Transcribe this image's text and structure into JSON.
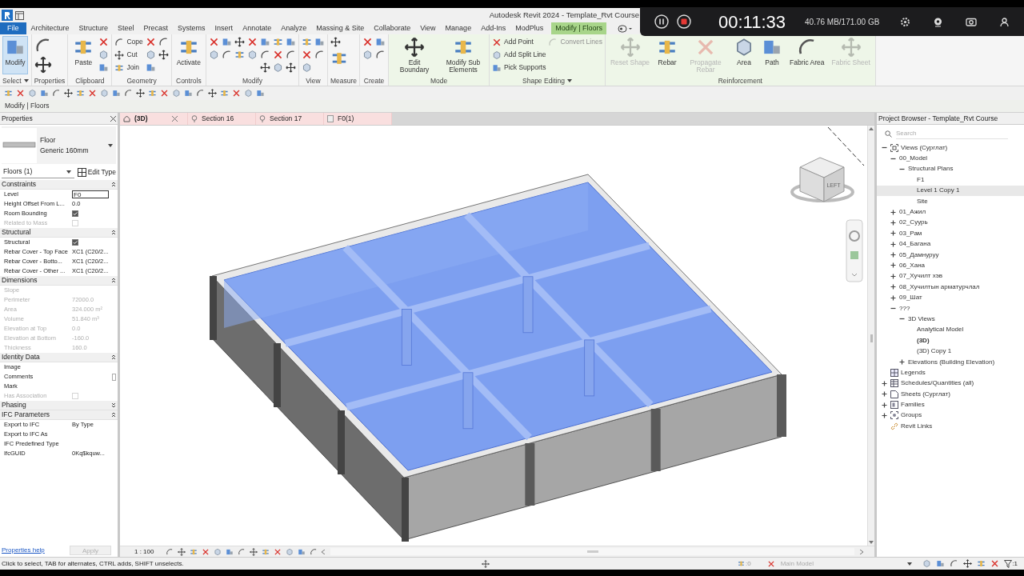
{
  "window": {
    "title": "Autodesk Revit 2024 - Template_Rvt Course"
  },
  "recorder": {
    "time": "00:11:33",
    "storage": "40.76 MB/171.00 GB"
  },
  "menu_tabs": [
    {
      "label": "File",
      "kind": "file",
      "selected": false
    },
    {
      "label": "Architecture",
      "kind": "tab",
      "selected": false
    },
    {
      "label": "Structure",
      "kind": "tab",
      "selected": false
    },
    {
      "label": "Steel",
      "kind": "tab",
      "selected": false
    },
    {
      "label": "Precast",
      "kind": "tab",
      "selected": false
    },
    {
      "label": "Systems",
      "kind": "tab",
      "selected": false
    },
    {
      "label": "Insert",
      "kind": "tab",
      "selected": false
    },
    {
      "label": "Annotate",
      "kind": "tab",
      "selected": false
    },
    {
      "label": "Analyze",
      "kind": "tab",
      "selected": false
    },
    {
      "label": "Massing & Site",
      "kind": "tab",
      "selected": false
    },
    {
      "label": "Collaborate",
      "kind": "tab",
      "selected": false
    },
    {
      "label": "View",
      "kind": "tab",
      "selected": false
    },
    {
      "label": "Manage",
      "kind": "tab",
      "selected": false
    },
    {
      "label": "Add-Ins",
      "kind": "tab",
      "selected": false
    },
    {
      "label": "ModPlus",
      "kind": "tab",
      "selected": false
    },
    {
      "label": "Modify | Floors",
      "kind": "contextual",
      "selected": true
    }
  ],
  "ribbon_panels": [
    {
      "title": "Select",
      "dropdown": true,
      "contextual": false,
      "columns": [
        [
          {
            "kind": "large",
            "label": "Modify",
            "selected": true
          }
        ]
      ]
    },
    {
      "title": "Properties",
      "contextual": false,
      "columns": [
        [
          {
            "kind": "big_icon"
          },
          {
            "kind": "big_icon"
          }
        ]
      ]
    },
    {
      "title": "Clipboard",
      "contextual": false,
      "columns": [
        [
          {
            "kind": "large",
            "label": "Paste",
            "selected": false
          }
        ],
        [
          {
            "kind": "icon"
          },
          {
            "kind": "icon"
          },
          {
            "kind": "icon"
          }
        ]
      ]
    },
    {
      "title": "Geometry",
      "contextual": false,
      "columns": [
        [
          {
            "kind": "small",
            "label": "Cope"
          },
          {
            "kind": "small",
            "label": "Cut"
          },
          {
            "kind": "small",
            "label": "Join"
          }
        ],
        [
          {
            "kind": "icon"
          },
          {
            "kind": "icon"
          },
          {
            "kind": "icon"
          }
        ],
        [
          {
            "kind": "icon"
          },
          {
            "kind": "icon"
          }
        ]
      ]
    },
    {
      "title": "Controls",
      "contextual": false,
      "columns": [
        [
          {
            "kind": "large",
            "label": "Activate",
            "selected": false
          }
        ]
      ]
    },
    {
      "title": "Modify",
      "contextual": false,
      "columns": [
        [
          {
            "kind": "icon"
          },
          {
            "kind": "icon"
          }
        ],
        [
          {
            "kind": "icon"
          },
          {
            "kind": "icon"
          }
        ],
        [
          {
            "kind": "icon"
          },
          {
            "kind": "icon"
          }
        ],
        [
          {
            "kind": "icon"
          },
          {
            "kind": "icon"
          }
        ],
        [
          {
            "kind": "icon"
          },
          {
            "kind": "icon"
          },
          {
            "kind": "icon"
          }
        ],
        [
          {
            "kind": "icon"
          },
          {
            "kind": "icon"
          },
          {
            "kind": "icon"
          }
        ],
        [
          {
            "kind": "icon"
          },
          {
            "kind": "icon"
          },
          {
            "kind": "icon"
          }
        ]
      ]
    },
    {
      "title": "View",
      "contextual": false,
      "columns": [
        [
          {
            "kind": "icon"
          },
          {
            "kind": "icon"
          },
          {
            "kind": "icon"
          }
        ],
        [
          {
            "kind": "icon"
          },
          {
            "kind": "icon"
          }
        ]
      ]
    },
    {
      "title": "Measure",
      "contextual": false,
      "columns": [
        [
          {
            "kind": "icon"
          },
          {
            "kind": "big_icon"
          }
        ]
      ]
    },
    {
      "title": "Create",
      "contextual": false,
      "columns": [
        [
          {
            "kind": "icon"
          },
          {
            "kind": "icon"
          }
        ],
        [
          {
            "kind": "icon"
          },
          {
            "kind": "icon"
          }
        ]
      ]
    },
    {
      "title": "Mode",
      "contextual": true,
      "columns": [
        [
          {
            "kind": "large",
            "label": "Edit Boundary",
            "selected": false
          }
        ],
        [
          {
            "kind": "large",
            "label": "Modify Sub Elements",
            "selected": false
          }
        ]
      ]
    },
    {
      "title": "Shape Editing",
      "dropdown": true,
      "contextual": true,
      "columns": [
        [
          {
            "kind": "small",
            "label": "Add Point"
          },
          {
            "kind": "small",
            "label": "Add Split Line"
          },
          {
            "kind": "small",
            "label": "Pick Supports"
          }
        ],
        [
          {
            "kind": "small",
            "label": "Convert Lines",
            "disabled": true
          }
        ]
      ]
    },
    {
      "title": "Reinforcement",
      "contextual": true,
      "columns": [
        [
          {
            "kind": "large",
            "label": "Reset Shape",
            "disabled": true
          }
        ],
        [
          {
            "kind": "large",
            "label": "Rebar",
            "selected": false
          }
        ],
        [
          {
            "kind": "large",
            "label": "Propagate Rebar",
            "disabled": true
          }
        ],
        [
          {
            "kind": "large",
            "label": "Area",
            "selected": false
          }
        ],
        [
          {
            "kind": "large",
            "label": "Path",
            "selected": false
          }
        ],
        [
          {
            "kind": "large",
            "label": "Fabric Area",
            "selected": false
          }
        ],
        [
          {
            "kind": "large",
            "label": "Fabric Sheet",
            "disabled": true
          }
        ]
      ]
    }
  ],
  "options_bar": {
    "context": "Modify | Floors"
  },
  "properties": {
    "title": "Properties",
    "type_family": "Floor",
    "type_name": "Generic 160mm",
    "selector": "Floors (1)",
    "edit_type": "Edit Type",
    "sections": [
      {
        "title": "Constraints",
        "expanded": true,
        "rows": [
          {
            "label": "Level",
            "kind": "input",
            "value": "F0"
          },
          {
            "label": "Height Offset From L...",
            "kind": "text",
            "value": "0.0"
          },
          {
            "label": "Room Bounding",
            "kind": "check",
            "checked": true,
            "disabled": false
          },
          {
            "label": "Related to Mass",
            "kind": "check",
            "checked": false,
            "disabled": true
          }
        ]
      },
      {
        "title": "Structural",
        "expanded": true,
        "rows": [
          {
            "label": "Structural",
            "kind": "check",
            "checked": true,
            "disabled": false
          },
          {
            "label": "Rebar Cover - Top Face",
            "kind": "text",
            "value": "XC1 (C20/2..."
          },
          {
            "label": "Rebar Cover - Botto...",
            "kind": "text",
            "value": "XC1 (C20/2..."
          },
          {
            "label": "Rebar Cover - Other ...",
            "kind": "text",
            "value": "XC1 (C20/2..."
          }
        ]
      },
      {
        "title": "Dimensions",
        "expanded": true,
        "rows": [
          {
            "label": "Slope",
            "kind": "text",
            "disabled": true
          },
          {
            "label": "Perimeter",
            "kind": "text",
            "value": "72000.0",
            "disabled": true
          },
          {
            "label": "Area",
            "kind": "text",
            "value": "324.000 m²",
            "disabled": true
          },
          {
            "label": "Volume",
            "kind": "text",
            "value": "51.840 m³",
            "disabled": true
          },
          {
            "label": "Elevation at Top",
            "kind": "text",
            "value": "0.0",
            "disabled": true
          },
          {
            "label": "Elevation at Bottom",
            "kind": "text",
            "value": "-160.0",
            "disabled": true
          },
          {
            "label": "Thickness",
            "kind": "text",
            "value": "160.0",
            "disabled": true
          }
        ]
      },
      {
        "title": "Identity Data",
        "expanded": true,
        "rows": [
          {
            "label": "Image",
            "kind": "text"
          },
          {
            "label": "Comments",
            "kind": "multiline"
          },
          {
            "label": "Mark",
            "kind": "text"
          },
          {
            "label": "Has Association",
            "kind": "check",
            "checked": false,
            "disabled": true
          }
        ]
      },
      {
        "title": "Phasing",
        "expanded": false
      },
      {
        "title": "IFC Parameters",
        "expanded": true,
        "rows": [
          {
            "label": "Export to IFC",
            "kind": "text",
            "value": "By Type"
          },
          {
            "label": "Export to IFC As",
            "kind": "text"
          },
          {
            "label": "IFC Predefined Type",
            "kind": "text"
          },
          {
            "label": "IfcGUID",
            "kind": "text",
            "value": "0Kq$kquw..."
          }
        ]
      }
    ],
    "help_link": "Properties help",
    "apply": "Apply"
  },
  "view_tabs": [
    {
      "label": "(3D)",
      "kind": "model",
      "selected": true
    },
    {
      "label": "Section 16",
      "kind": "section",
      "selected": false
    },
    {
      "label": "Section 17",
      "kind": "section",
      "selected": false
    },
    {
      "label": "F0(1)",
      "kind": "plan",
      "selected": false
    }
  ],
  "viewcube": {
    "face": "LEFT"
  },
  "view_bar": {
    "scale": "1 : 100"
  },
  "project_browser": {
    "title": "Project Browser - Template_Rvt Course",
    "search_placeholder": "Search",
    "tree": [
      {
        "label": "Views (Сурглат)",
        "kind": "views",
        "expanded": true,
        "children": [
          {
            "label": "00_Model",
            "expanded": true,
            "children": [
              {
                "label": "Structural Plans",
                "expanded": true,
                "children": [
                  {
                    "label": "F1",
                    "selected": false
                  },
                  {
                    "label": "Level 1 Copy 1",
                    "selected": true
                  },
                  {
                    "label": "Site",
                    "selected": false
                  }
                ]
              }
            ]
          },
          {
            "label": "01_Ажил",
            "expanded": false
          },
          {
            "label": "02_Суурь",
            "expanded": false
          },
          {
            "label": "03_Рам",
            "expanded": false
          },
          {
            "label": "04_Багана",
            "expanded": false
          },
          {
            "label": "05_Дамнуруу",
            "expanded": false
          },
          {
            "label": "06_Хана",
            "expanded": false
          },
          {
            "label": "07_Хучилт хэв",
            "expanded": false
          },
          {
            "label": "08_Хучилтын арматурчлал",
            "expanded": false
          },
          {
            "label": "09_Шат",
            "expanded": false
          },
          {
            "label": "???",
            "expanded": true,
            "children": [
              {
                "label": "3D Views",
                "expanded": true,
                "children": [
                  {
                    "label": "Analytical Model",
                    "selected": false,
                    "current": false
                  },
                  {
                    "label": "(3D)",
                    "selected": false,
                    "current": true
                  },
                  {
                    "label": "(3D) Copy 1",
                    "selected": false,
                    "current": false
                  }
                ]
              },
              {
                "label": "Elevations (Building Elevation)",
                "expanded": false
              }
            ]
          }
        ]
      },
      {
        "label": "Legends",
        "kind": "legends"
      },
      {
        "label": "Schedules/Quantities (all)",
        "kind": "schedules",
        "expanded": false
      },
      {
        "label": "Sheets (Сурглат)",
        "kind": "sheets",
        "expanded": false
      },
      {
        "label": "Families",
        "kind": "families",
        "expanded": false
      },
      {
        "label": "Groups",
        "kind": "groups",
        "expanded": false
      },
      {
        "label": "Revit Links",
        "kind": "links"
      }
    ]
  },
  "status_bar": {
    "message": "Click to select, TAB for alternates, CTRL adds, SHIFT unselects.",
    "workset_count": ":0",
    "model": "Main Model",
    "filter_count": ":1"
  }
}
